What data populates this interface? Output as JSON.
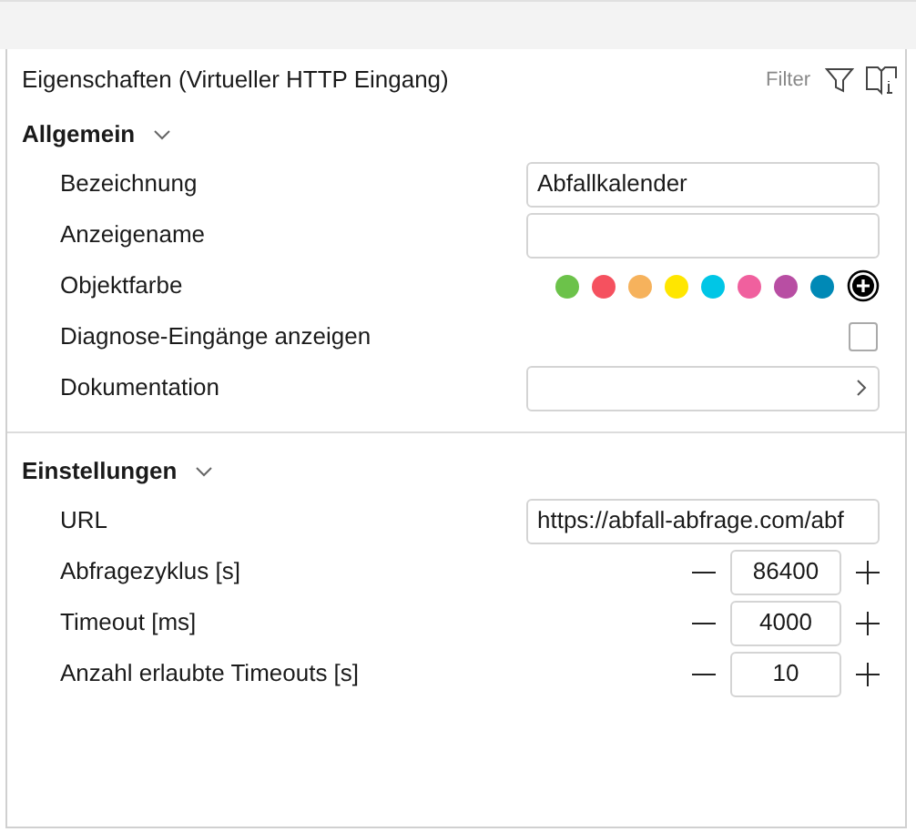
{
  "panel": {
    "title": "Eigenschaften (Virtueller HTTP Eingang)",
    "filter_label": "Filter"
  },
  "sections": [
    {
      "title": "Allgemein",
      "expanded": true,
      "rows": [
        {
          "kind": "text",
          "label": "Bezeichnung",
          "value": "Abfallkalender"
        },
        {
          "kind": "text",
          "label": "Anzeigename"
        },
        {
          "kind": "color",
          "label": "Objektfarbe",
          "colors": [
            {
              "color": "#6cc24a"
            },
            {
              "color": "#f5515f"
            },
            {
              "color": "#f6b25c"
            },
            {
              "color": "#ffe600"
            },
            {
              "color": "#00c6e6"
            },
            {
              "color": "#f0609e"
            },
            {
              "color": "#b84ea3"
            },
            {
              "color": "#0089b6"
            }
          ]
        },
        {
          "kind": "checkbox",
          "label": "Diagnose-Eingänge anzeigen",
          "checked": false
        },
        {
          "kind": "link",
          "label": "Dokumentation"
        }
      ]
    },
    {
      "title": "Einstellungen",
      "expanded": true,
      "rows": [
        {
          "kind": "text",
          "label": "URL",
          "value": "https://abfall-abfrage.com/abf"
        },
        {
          "kind": "number",
          "label": "Abfragezyklus [s]",
          "value": "86400"
        },
        {
          "kind": "number",
          "label": "Timeout [ms]",
          "value": "4000"
        },
        {
          "kind": "number",
          "label": "Anzahl erlaubte Timeouts [s]",
          "value": "10"
        }
      ]
    }
  ]
}
